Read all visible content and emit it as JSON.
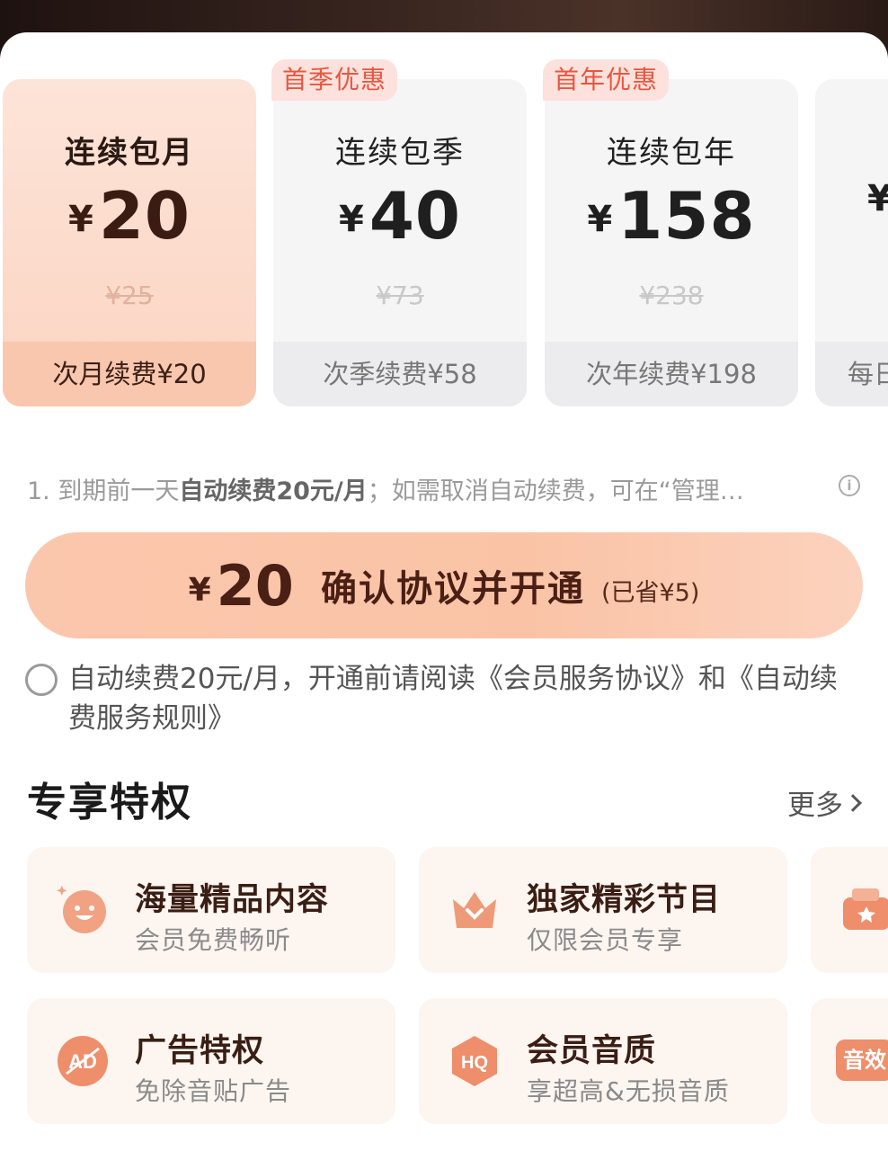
{
  "plans": [
    {
      "name": "连续包月",
      "yen": "¥",
      "price": "20",
      "original": "¥25",
      "renew": "次月续费¥20",
      "badge": ""
    },
    {
      "name": "连续包季",
      "yen": "¥",
      "price": "40",
      "original": "¥73",
      "renew": "次季续费¥58",
      "badge": "首季优惠"
    },
    {
      "name": "连续包年",
      "yen": "¥",
      "price": "158",
      "original": "¥238",
      "renew": "次年续费¥198",
      "badge": "首年优惠"
    },
    {
      "yen": "¥",
      "renew": "每日"
    }
  ],
  "notice": {
    "prefix": "1. 到期前一天",
    "bold": "自动续费20元/月",
    "suffix": "；如需取消自动续费，可在“管理…"
  },
  "cta": {
    "yen": "¥",
    "amount": "20",
    "label": "确认协议并开通",
    "saved": "(已省¥5)"
  },
  "agreement": {
    "text": "自动续费20元/月，开通前请阅读《会员服务协议》和《自动续费服务规则》"
  },
  "privileges": {
    "title": "专享特权",
    "more": "更多",
    "items": [
      {
        "title": "海量精品内容",
        "subtitle": "会员免费畅听",
        "icon": "smile-icon"
      },
      {
        "title": "独家精彩节目",
        "subtitle": "仅限会员专享",
        "icon": "crown-icon"
      },
      {
        "title": "广告特权",
        "subtitle": "免除音贴广告",
        "icon": "ad-icon"
      },
      {
        "title": "会员音质",
        "subtitle": "享超高&无损音质",
        "icon": "hq-icon"
      }
    ],
    "partial_label": "音效"
  },
  "colors": {
    "accent": "#fac3a6",
    "badge_text": "#e9563f",
    "dark_text": "#3a1e14"
  }
}
